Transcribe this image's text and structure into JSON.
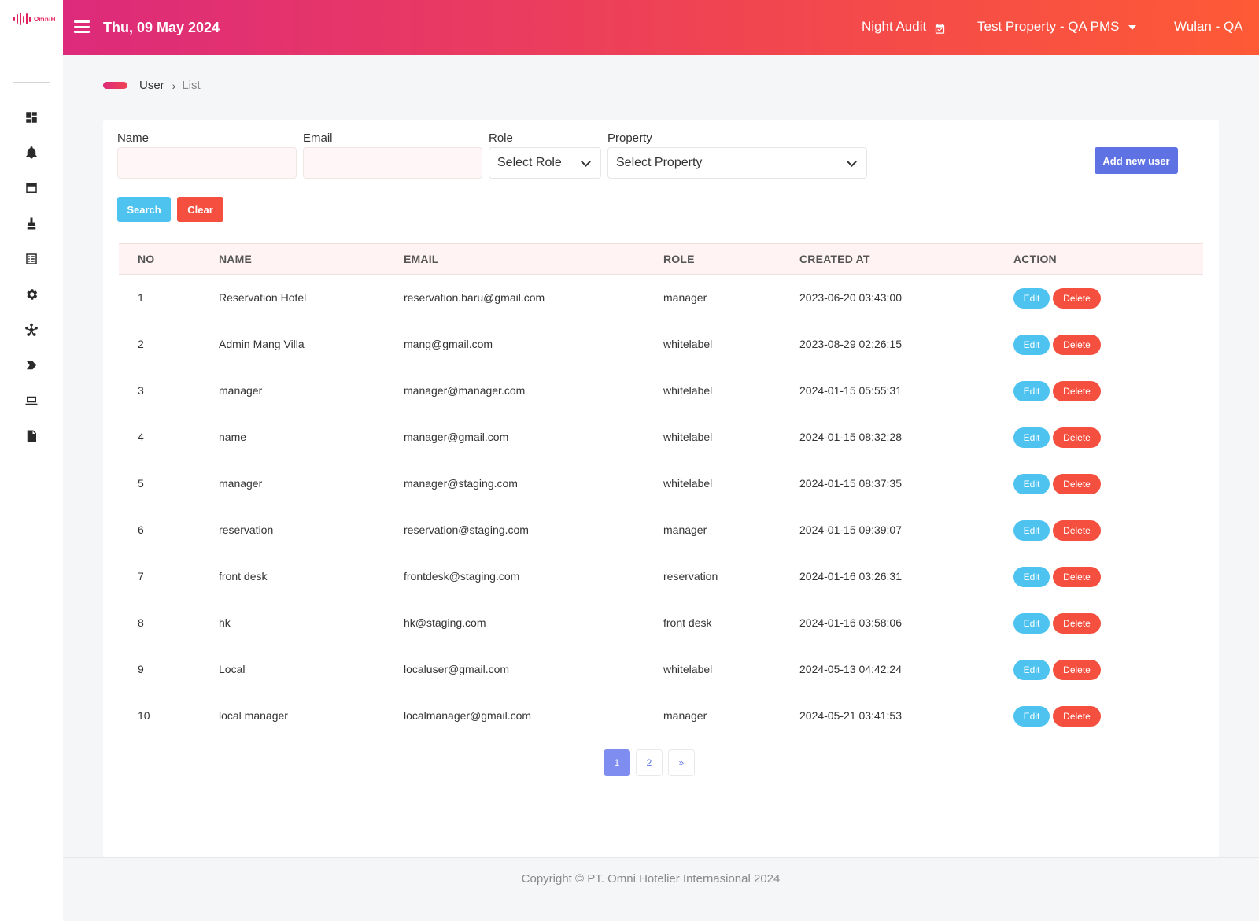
{
  "brand": {
    "logo_text": "OmniH",
    "accent": "#e0245e"
  },
  "header": {
    "date": "Thu, 09 May 2024",
    "night_audit_label": "Night Audit",
    "property": "Test Property - QA PMS",
    "user": "Wulan - QA",
    "gradient": [
      "#dd2a7b",
      "#f04452",
      "#fe5a36"
    ]
  },
  "sidebar": {
    "icons": [
      "dashboard-icon",
      "notification-bell-icon",
      "window-icon",
      "cleaning-icon",
      "list-icon",
      "settings-gear-icon",
      "network-icon",
      "chevron-tag-icon",
      "laptop-icon",
      "report-icon"
    ]
  },
  "breadcrumb": {
    "section": "User",
    "separator": "›",
    "page": "List"
  },
  "filters": {
    "name_label": "Name",
    "email_label": "Email",
    "role_label": "Role",
    "role_value": "Select Role",
    "property_label": "Property",
    "property_value": "Select Property",
    "add_button": "Add new user",
    "search_button": "Search",
    "clear_button": "Clear"
  },
  "table": {
    "headers": {
      "no": "NO",
      "name": "NAME",
      "email": "EMAIL",
      "role": "ROLE",
      "created_at": "CREATED AT",
      "action": "ACTION"
    },
    "edit_label": "Edit",
    "delete_label": "Delete",
    "rows": [
      {
        "no": "1",
        "name": "Reservation Hotel",
        "email": "reservation.baru@gmail.com",
        "role": "manager",
        "created_at": "2023-06-20 03:43:00"
      },
      {
        "no": "2",
        "name": "Admin Mang Villa",
        "email": "mang@gmail.com",
        "role": "whitelabel",
        "created_at": "2023-08-29 02:26:15"
      },
      {
        "no": "3",
        "name": "manager",
        "email": "manager@manager.com",
        "role": "whitelabel",
        "created_at": "2024-01-15 05:55:31"
      },
      {
        "no": "4",
        "name": "name",
        "email": "manager@gmail.com",
        "role": "whitelabel",
        "created_at": "2024-01-15 08:32:28"
      },
      {
        "no": "5",
        "name": "manager",
        "email": "manager@staging.com",
        "role": "whitelabel",
        "created_at": "2024-01-15 08:37:35"
      },
      {
        "no": "6",
        "name": "reservation",
        "email": "reservation@staging.com",
        "role": "manager",
        "created_at": "2024-01-15 09:39:07"
      },
      {
        "no": "7",
        "name": "front desk",
        "email": "frontdesk@staging.com",
        "role": "reservation",
        "created_at": "2024-01-16 03:26:31"
      },
      {
        "no": "8",
        "name": "hk",
        "email": "hk@staging.com",
        "role": "front desk",
        "created_at": "2024-01-16 03:58:06"
      },
      {
        "no": "9",
        "name": "Local",
        "email": "localuser@gmail.com",
        "role": "whitelabel",
        "created_at": "2024-05-13 04:42:24"
      },
      {
        "no": "10",
        "name": "local manager",
        "email": "localmanager@gmail.com",
        "role": "manager",
        "created_at": "2024-05-21 03:41:53"
      }
    ]
  },
  "pagination": {
    "pages": [
      "1",
      "2"
    ],
    "current": "1",
    "next": "»"
  },
  "footer": {
    "copyright": "Copyright © PT. Omni Hotelier Internasional 2024"
  }
}
